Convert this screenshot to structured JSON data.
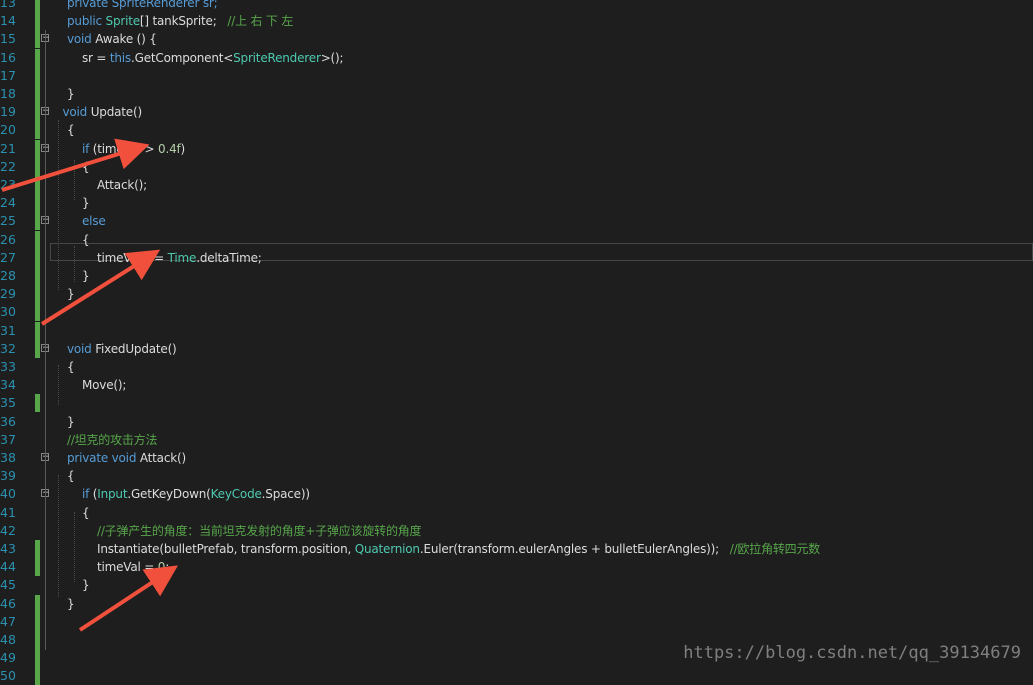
{
  "lines": [
    {
      "n": "13",
      "indent": 1,
      "fold": false,
      "mark": true,
      "tokens": [
        {
          "t": "private SpriteRenderer sr;",
          "c": "kw"
        }
      ]
    },
    {
      "n": "14",
      "indent": 1,
      "fold": false,
      "mark": true,
      "tokens": [
        {
          "t": "public ",
          "c": "kw"
        },
        {
          "t": "Sprite",
          "c": "ty"
        },
        {
          "t": "[] tankSprite;   ",
          "c": ""
        },
        {
          "t": "//上 右 下 左",
          "c": "cm"
        }
      ]
    },
    {
      "n": "15",
      "indent": 1,
      "fold": true,
      "mark": true,
      "tokens": [
        {
          "t": "void ",
          "c": "kw"
        },
        {
          "t": "Awake",
          "c": ""
        },
        {
          "t": " () {",
          "c": ""
        }
      ]
    },
    {
      "n": "16",
      "indent": 2,
      "fold": false,
      "mark": true,
      "tokens": [
        {
          "t": "sr = ",
          "c": ""
        },
        {
          "t": "this",
          "c": "kw"
        },
        {
          "t": ".GetComponent<",
          "c": ""
        },
        {
          "t": "SpriteRenderer",
          "c": "ty"
        },
        {
          "t": ">();",
          "c": ""
        }
      ]
    },
    {
      "n": "17",
      "indent": 0,
      "fold": false,
      "mark": true,
      "tokens": []
    },
    {
      "n": "18",
      "indent": 1,
      "fold": false,
      "mark": true,
      "tokens": [
        {
          "t": "}",
          "c": ""
        }
      ]
    },
    {
      "n": "19",
      "indent": 0.7,
      "fold": true,
      "mark": true,
      "tokens": [
        {
          "t": "void ",
          "c": "kw"
        },
        {
          "t": "Update",
          "c": ""
        },
        {
          "t": "()",
          "c": ""
        }
      ]
    },
    {
      "n": "20",
      "indent": 1,
      "fold": false,
      "mark": true,
      "tokens": [
        {
          "t": "{",
          "c": ""
        }
      ]
    },
    {
      "n": "21",
      "indent": 2,
      "fold": true,
      "mark": true,
      "tokens": [
        {
          "t": "if ",
          "c": "kw"
        },
        {
          "t": "(timeVal > ",
          "c": ""
        },
        {
          "t": "0.4f",
          "c": "nu"
        },
        {
          "t": ")",
          "c": ""
        }
      ]
    },
    {
      "n": "22",
      "indent": 2,
      "fold": false,
      "mark": true,
      "tokens": [
        {
          "t": "{",
          "c": ""
        }
      ]
    },
    {
      "n": "23",
      "indent": 3,
      "fold": false,
      "mark": true,
      "tokens": [
        {
          "t": "Attack();",
          "c": ""
        }
      ]
    },
    {
      "n": "24",
      "indent": 2,
      "fold": false,
      "mark": true,
      "tokens": [
        {
          "t": "}",
          "c": ""
        }
      ]
    },
    {
      "n": "25",
      "indent": 2,
      "fold": true,
      "mark": true,
      "tokens": [
        {
          "t": "else",
          "c": "kw"
        }
      ]
    },
    {
      "n": "26",
      "indent": 2,
      "fold": false,
      "mark": true,
      "tokens": [
        {
          "t": "{",
          "c": ""
        }
      ]
    },
    {
      "n": "27",
      "indent": 3,
      "fold": false,
      "mark": true,
      "tokens": [
        {
          "t": "timeVal += ",
          "c": ""
        },
        {
          "t": "Time",
          "c": "ty"
        },
        {
          "t": ".deltaTime;",
          "c": ""
        }
      ]
    },
    {
      "n": "28",
      "indent": 2,
      "fold": false,
      "mark": true,
      "tokens": [
        {
          "t": "}",
          "c": ""
        }
      ]
    },
    {
      "n": "29",
      "indent": 1,
      "fold": false,
      "mark": true,
      "tokens": [
        {
          "t": "}",
          "c": ""
        }
      ]
    },
    {
      "n": "30",
      "indent": 0,
      "fold": false,
      "mark": true,
      "tokens": []
    },
    {
      "n": "31",
      "indent": 0,
      "fold": false,
      "mark": true,
      "tokens": []
    },
    {
      "n": "32",
      "indent": 1,
      "fold": true,
      "mark": true,
      "tokens": [
        {
          "t": "void ",
          "c": "kw"
        },
        {
          "t": "FixedUpdate",
          "c": ""
        },
        {
          "t": "()",
          "c": ""
        }
      ]
    },
    {
      "n": "33",
      "indent": 1,
      "fold": false,
      "mark": false,
      "tokens": [
        {
          "t": "{",
          "c": ""
        }
      ]
    },
    {
      "n": "34",
      "indent": 2,
      "fold": false,
      "mark": false,
      "tokens": [
        {
          "t": "Move();",
          "c": ""
        }
      ]
    },
    {
      "n": "35",
      "indent": 0,
      "fold": false,
      "mark": true,
      "tokens": []
    },
    {
      "n": "36",
      "indent": 1,
      "fold": false,
      "mark": false,
      "tokens": [
        {
          "t": "}",
          "c": ""
        }
      ]
    },
    {
      "n": "37",
      "indent": 1,
      "fold": false,
      "mark": false,
      "tokens": [
        {
          "t": "//坦克的攻击方法",
          "c": "cm"
        }
      ]
    },
    {
      "n": "38",
      "indent": 1,
      "fold": true,
      "mark": false,
      "tokens": [
        {
          "t": "private void ",
          "c": "kw"
        },
        {
          "t": "Attack",
          "c": ""
        },
        {
          "t": "()",
          "c": ""
        }
      ]
    },
    {
      "n": "39",
      "indent": 1,
      "fold": false,
      "mark": false,
      "tokens": [
        {
          "t": "{",
          "c": ""
        }
      ]
    },
    {
      "n": "40",
      "indent": 2,
      "fold": true,
      "mark": false,
      "tokens": [
        {
          "t": "if ",
          "c": "kw"
        },
        {
          "t": "(",
          "c": ""
        },
        {
          "t": "Input",
          "c": "ty"
        },
        {
          "t": ".GetKeyDown(",
          "c": ""
        },
        {
          "t": "KeyCode",
          "c": "ty"
        },
        {
          "t": ".Space))",
          "c": ""
        }
      ]
    },
    {
      "n": "41",
      "indent": 2,
      "fold": false,
      "mark": false,
      "tokens": [
        {
          "t": "{",
          "c": ""
        }
      ]
    },
    {
      "n": "42",
      "indent": 3,
      "fold": false,
      "mark": false,
      "tokens": [
        {
          "t": "//子弹产生的角度：当前坦克发射的角度+子弹应该旋转的角度",
          "c": "cm"
        }
      ]
    },
    {
      "n": "43",
      "indent": 3,
      "fold": false,
      "mark": true,
      "tokens": [
        {
          "t": "Instantiate(bulletPrefab, transform.position, ",
          "c": ""
        },
        {
          "t": "Quaternion",
          "c": "ty"
        },
        {
          "t": ".Euler(transform.eulerAngles + bulletEulerAngles));   ",
          "c": ""
        },
        {
          "t": "//欧拉角转四元数",
          "c": "cm"
        }
      ]
    },
    {
      "n": "44",
      "indent": 3,
      "fold": false,
      "mark": true,
      "tokens": [
        {
          "t": "timeVal = ",
          "c": ""
        },
        {
          "t": "0",
          "c": "nu"
        },
        {
          "t": ";",
          "c": ""
        }
      ]
    },
    {
      "n": "45",
      "indent": 2,
      "fold": false,
      "mark": false,
      "tokens": [
        {
          "t": "}",
          "c": ""
        }
      ]
    },
    {
      "n": "46",
      "indent": 1,
      "fold": false,
      "mark": true,
      "tokens": [
        {
          "t": "}",
          "c": ""
        }
      ]
    },
    {
      "n": "47",
      "indent": 0,
      "fold": false,
      "mark": true,
      "tokens": []
    },
    {
      "n": "48",
      "indent": 0,
      "fold": false,
      "mark": true,
      "tokens": []
    },
    {
      "n": "49",
      "indent": 0,
      "fold": false,
      "mark": true,
      "tokens": []
    },
    {
      "n": "50",
      "indent": 0,
      "fold": false,
      "mark": true,
      "tokens": []
    }
  ],
  "fold_glyph": "−",
  "watermark": "https://blog.csdn.net/qq_39134679",
  "colors": {
    "background": "#1e1e1e",
    "line_number": "#2b91af",
    "keyword": "#569cd6",
    "type": "#4ec9b0",
    "comment": "#57a64a",
    "number": "#b5cea8",
    "text": "#dcdcdc",
    "change_mark": "#57a64a",
    "arrow": "#f0503c"
  }
}
